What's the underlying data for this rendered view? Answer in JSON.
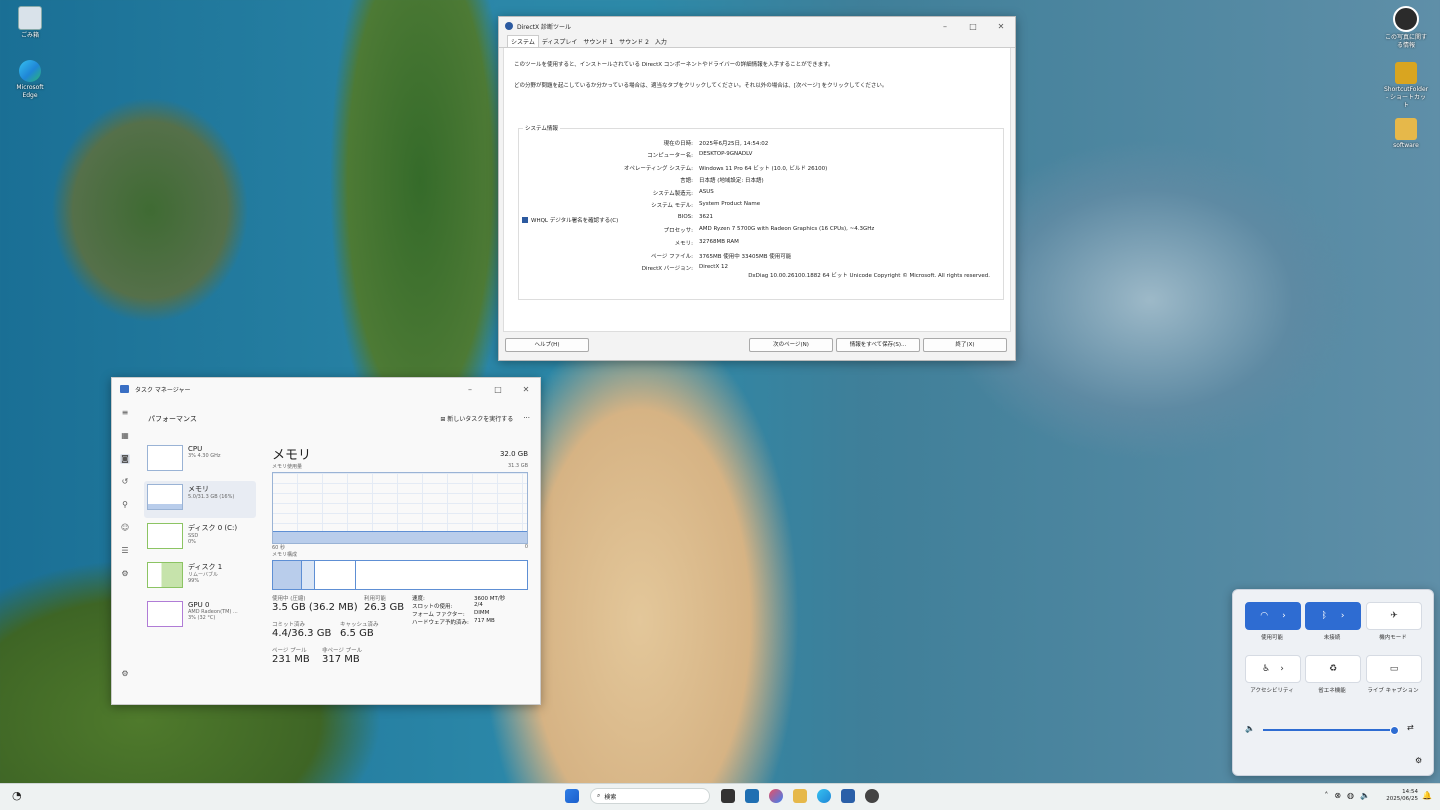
{
  "desktop": {
    "icons_left": [
      {
        "label": "ごみ箱",
        "color": "#d9e2ea"
      },
      {
        "label": "Microsoft Edge",
        "color": "#1f86d6"
      }
    ],
    "icons_right": [
      {
        "label": "この写真に関する情報",
        "color": "#2b2b2b"
      },
      {
        "label": "ShortcutFolder - ショートカット",
        "color": "#d9a520"
      },
      {
        "label": "software",
        "color": "#e6b84a"
      }
    ]
  },
  "dxdiag": {
    "title": "DirectX 診断ツール",
    "tabs": [
      "システム",
      "ディスプレイ",
      "サウンド 1",
      "サウンド 2",
      "入力"
    ],
    "intro1": "このツールを使用すると、インストールされている DirectX コンポーネントやドライバーの詳細情報を入手することができます。",
    "intro2": "どの分野が問題を起こしているか分かっている場合は、適当なタブをクリックしてください。それ以外の場合は、[次ページ] をクリックしてください。",
    "group_title": "システム情報",
    "rows": [
      {
        "k": "現在の日時:",
        "v": "2025年6月25日, 14:54:02"
      },
      {
        "k": "コンピューター名:",
        "v": "DESKTOP-9GNADLV"
      },
      {
        "k": "オペレーティング システム:",
        "v": "Windows 11 Pro 64 ビット (10.0, ビルド 26100)"
      },
      {
        "k": "言語:",
        "v": "日本語 (地域設定: 日本語)"
      },
      {
        "k": "システム製造元:",
        "v": "ASUS"
      },
      {
        "k": "システム モデル:",
        "v": "System Product Name"
      },
      {
        "k": "BIOS:",
        "v": "3621"
      },
      {
        "k": "プロセッサ:",
        "v": "AMD Ryzen 7 5700G with Radeon Graphics        (16 CPUs), ~4.3GHz"
      },
      {
        "k": "メモリ:",
        "v": "32768MB RAM"
      },
      {
        "k": "ページ ファイル:",
        "v": "3765MB 使用中 33405MB 使用可能"
      },
      {
        "k": "DirectX バージョン:",
        "v": "DirectX 12"
      }
    ],
    "whql": "WHQL デジタル署名を確認する(C)",
    "version": "DxDiag 10.00.26100.1882 64 ビット Unicode  Copyright © Microsoft. All rights reserved.",
    "buttons": {
      "help": "ヘルプ(H)",
      "next": "次のページ(N)",
      "save": "情報をすべて保存(S)...",
      "exit": "終了(X)"
    }
  },
  "taskmgr": {
    "title": "タスク マネージャー",
    "section": "パフォーマンス",
    "run_task": "新しいタスクを実行する",
    "more": "···",
    "items": [
      {
        "name": "CPU",
        "sub1": "3%  4.30 GHz",
        "sub2": ""
      },
      {
        "name": "メモリ",
        "sub1": "5.0/31.3 GB (16%)",
        "sub2": ""
      },
      {
        "name": "ディスク 0 (C:)",
        "sub1": "SSD",
        "sub2": "0%"
      },
      {
        "name": "ディスク 1",
        "sub1": "リムーバブル",
        "sub2": "99%"
      },
      {
        "name": "GPU 0",
        "sub1": "AMD Radeon(TM) ...",
        "sub2": "3% (32 °C)"
      }
    ],
    "main_title": "メモリ",
    "total": "32.0 GB",
    "usage_label": "メモリ使用量",
    "usage_max": "31.3 GB",
    "time_left": "60 秒",
    "time_right": "0",
    "usage_fraction": 0.16,
    "composition_label": "メモリ構成",
    "stats": {
      "in_use_k": "使用中 (圧縮)",
      "in_use_v": "3.5 GB (36.2 MB)",
      "avail_k": "利用可能",
      "avail_v": "26.3 GB",
      "commit_k": "コミット済み",
      "commit_v": "4.4/36.3 GB",
      "cached_k": "キャッシュ済み",
      "cached_v": "6.5 GB",
      "paged_k": "ページ プール",
      "paged_v": "231 MB",
      "nonpaged_k": "非ページ プール",
      "nonpaged_v": "317 MB"
    },
    "details": [
      {
        "k": "速度:",
        "v": "3600 MT/秒"
      },
      {
        "k": "スロットの使用:",
        "v": "2/4"
      },
      {
        "k": "フォーム ファクター:",
        "v": "DIMM"
      },
      {
        "k": "ハードウェア予約済み:",
        "v": "717 MB"
      }
    ]
  },
  "quick_settings": {
    "tiles": [
      {
        "label": "使用可能",
        "icon": "wifi-icon"
      },
      {
        "label": "未接続",
        "icon": "bluetooth-icon"
      },
      {
        "label": "機内モード",
        "icon": "airplane-icon"
      },
      {
        "label": "アクセシビリティ",
        "icon": "accessibility-icon"
      },
      {
        "label": "省エネ機能",
        "icon": "energy-saver-icon"
      },
      {
        "label": "ライブ キャプション",
        "icon": "caption-icon"
      }
    ],
    "volume_level": 0.97
  },
  "taskbar": {
    "search_placeholder": "検索",
    "time": "14:54",
    "date": "2025/06/25"
  }
}
